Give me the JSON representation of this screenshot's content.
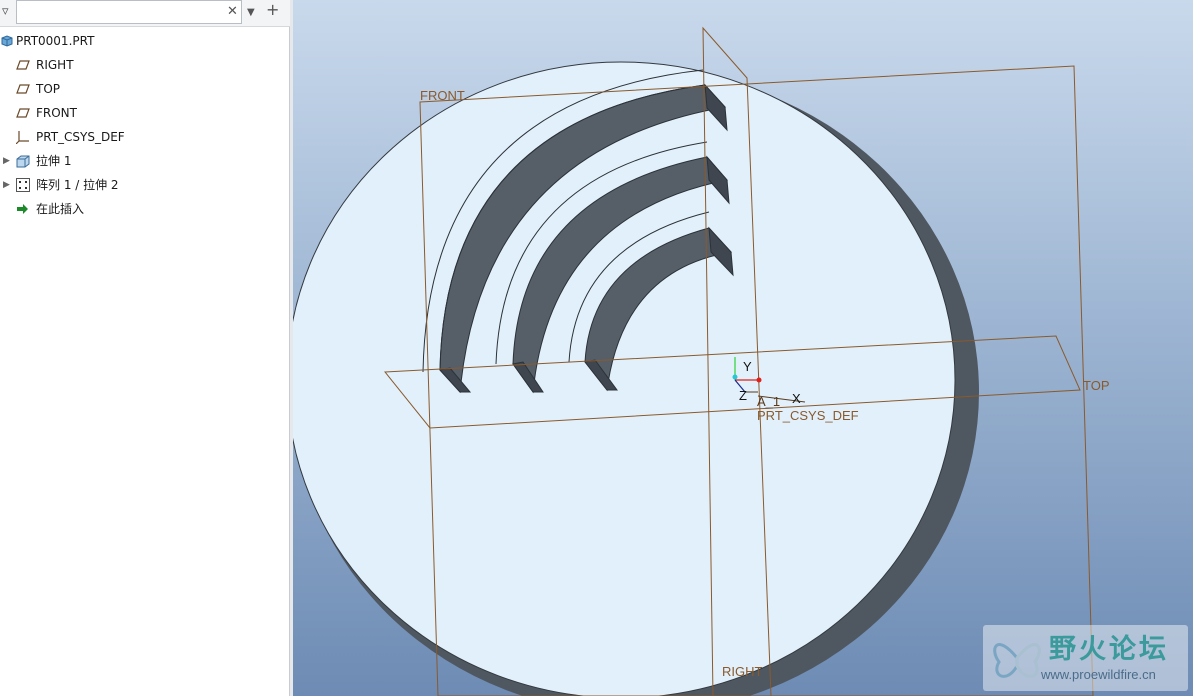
{
  "filter": {
    "search_value": "",
    "search_placeholder": ""
  },
  "tree": {
    "items": [
      {
        "label": "PRT0001.PRT",
        "icon": "part-icon",
        "expandable": false
      },
      {
        "label": "RIGHT",
        "icon": "datum-plane-icon",
        "expandable": false
      },
      {
        "label": "TOP",
        "icon": "datum-plane-icon",
        "expandable": false
      },
      {
        "label": "FRONT",
        "icon": "datum-plane-icon",
        "expandable": false
      },
      {
        "label": "PRT_CSYS_DEF",
        "icon": "csys-icon",
        "expandable": false
      },
      {
        "label": "拉伸 1",
        "icon": "extrude-icon",
        "expandable": true
      },
      {
        "label": "阵列 1 / 拉伸 2",
        "icon": "pattern-icon",
        "expandable": true
      },
      {
        "label": "在此插入",
        "icon": "insert-here-arrow-icon",
        "expandable": false
      }
    ]
  },
  "viewport": {
    "plane_labels": {
      "front": "FRONT",
      "top": "TOP",
      "right": "RIGHT"
    },
    "csys_label": "PRT_CSYS_DEF",
    "axes": {
      "x": "X",
      "y": "Y",
      "z": "Z"
    },
    "axis_annotation": "A_1"
  },
  "watermark": {
    "title": "野火论坛",
    "url": "www.proewildfire.cn"
  },
  "colors": {
    "datum_plane": "#8a5a2c",
    "part_face": "#e2f0fb",
    "part_side": "#4f5761",
    "viewport_top": "#c9d9ec",
    "viewport_bottom": "#6d8bb4"
  }
}
